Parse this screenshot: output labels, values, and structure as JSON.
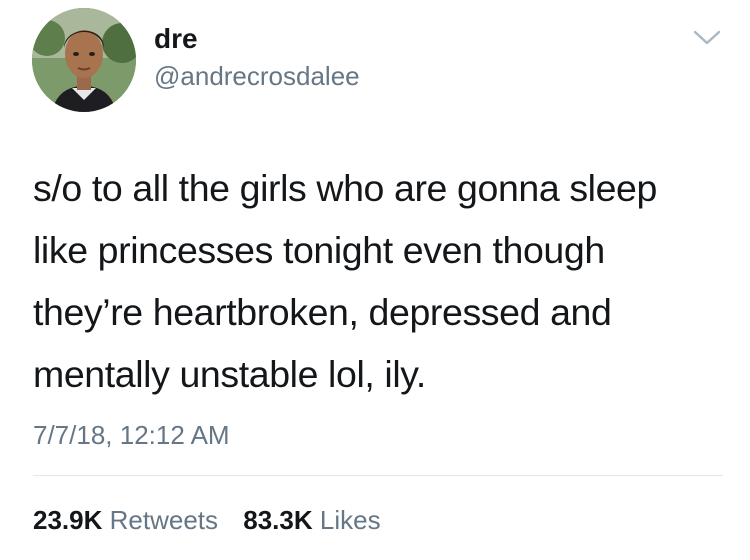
{
  "tweet": {
    "author": {
      "display_name": "dre",
      "handle": "@andrecrosdalee"
    },
    "text_lines": [
      "s/o to all the girls who are gonna sleep",
      "like princesses tonight even though",
      "they’re heartbroken, depressed and",
      "mentally unstable lol, ily."
    ],
    "timestamp": "7/7/18, 12:12 AM",
    "stats": {
      "retweets_count": "23.9K",
      "retweets_label": "Retweets",
      "likes_count": "83.3K",
      "likes_label": "Likes"
    },
    "icons": {
      "menu": "chevron-down-icon"
    },
    "colors": {
      "text": "#14171a",
      "secondary": "#657786",
      "divider": "#e1e8ed"
    }
  }
}
